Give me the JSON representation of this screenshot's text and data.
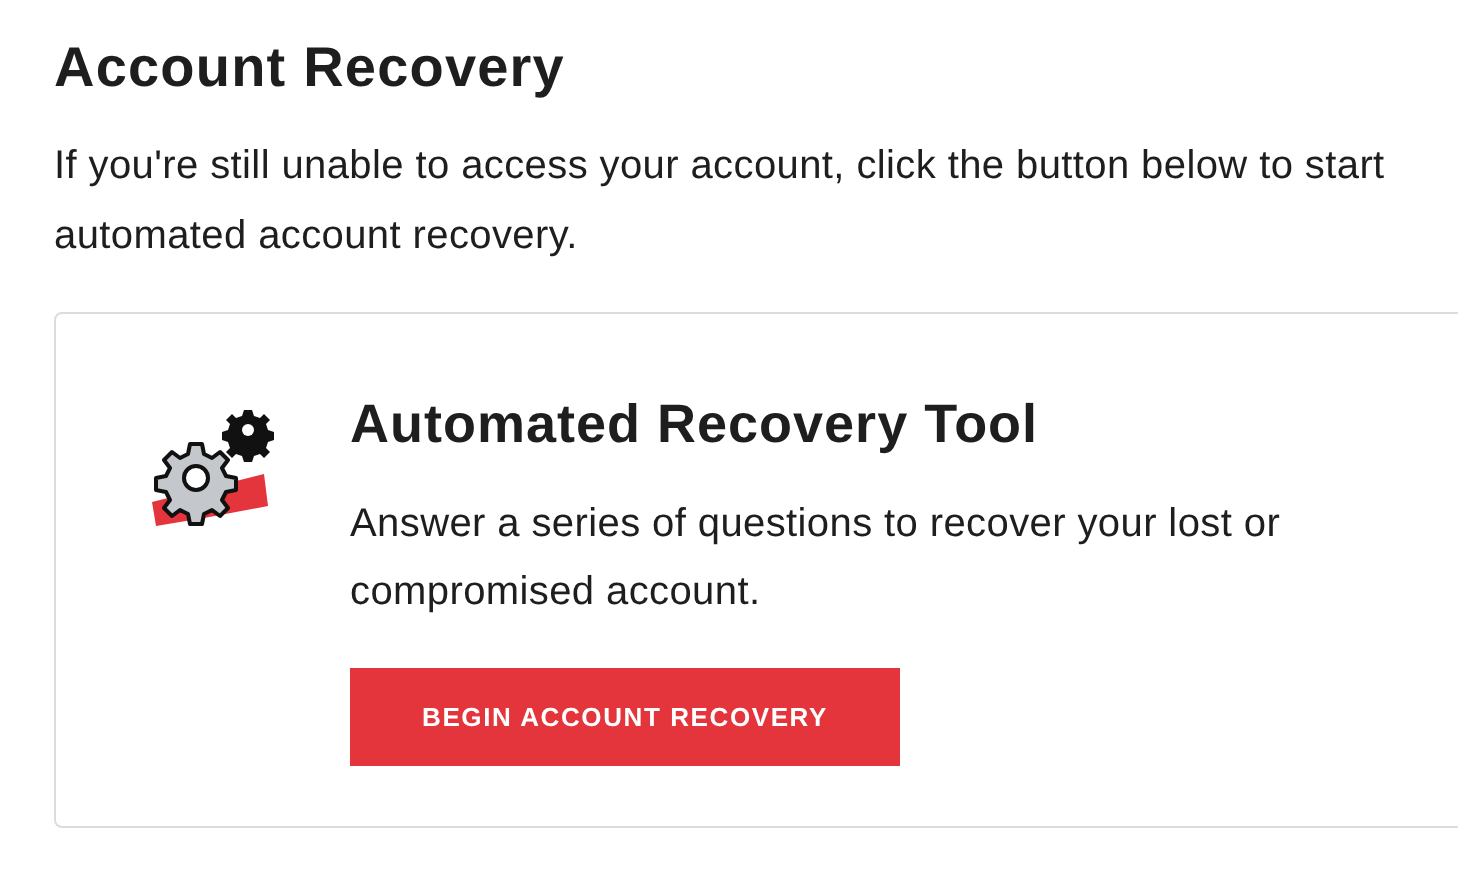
{
  "heading": "Account Recovery",
  "intro": "If you're still unable to access your account, click the button below to start automated account recovery.",
  "card": {
    "title": "Automated Recovery Tool",
    "description": "Answer a series of questions to recover your lost or compromised account.",
    "button": "BEGIN ACCOUNT RECOVERY"
  }
}
